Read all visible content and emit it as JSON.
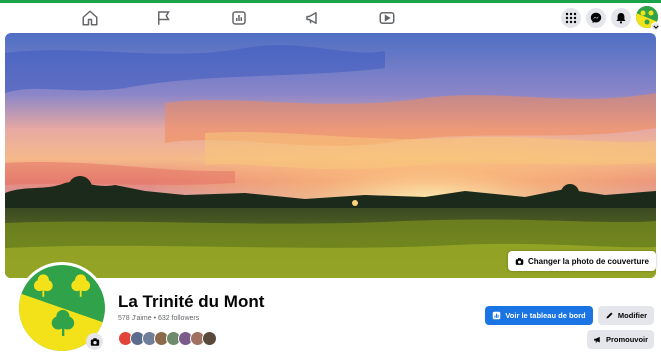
{
  "colors": {
    "accent_line": "#1aa34a",
    "primary_button": "#1b74e4",
    "grey_button": "#e4e6eb",
    "text_primary": "#050505",
    "text_secondary": "#65676b"
  },
  "topbar": {
    "nav_icons": [
      "home-icon",
      "flag-icon",
      "insights-icon",
      "megaphone-icon",
      "video-icon"
    ],
    "right_icons": [
      "menu-grid-icon",
      "messenger-icon",
      "notifications-bell-icon"
    ]
  },
  "cover": {
    "change_cover_label": "Changer la photo de couverture"
  },
  "page": {
    "name": "La Trinité du Mont",
    "stats": "578 J'aime • 632 followers"
  },
  "actions": {
    "dashboard_label": "Voir le tableau de bord",
    "edit_label": "Modifier",
    "promote_label": "Promouvoir"
  }
}
